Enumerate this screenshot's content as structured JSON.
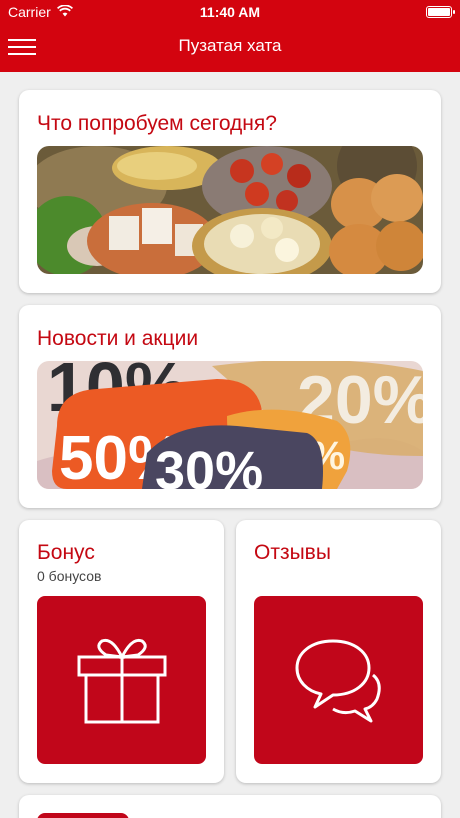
{
  "status_bar": {
    "carrier": "Carrier",
    "time": "11:40 AM"
  },
  "header": {
    "title": "Пузатая хата"
  },
  "cards": {
    "menu": {
      "title": "Что попробуем сегодня?",
      "image_icon": "food-platter-photo"
    },
    "news": {
      "title": "Новости и акции",
      "image_icon": "discount-tags-photo",
      "tags": [
        "10%",
        "50%",
        "30%",
        "20%",
        "30%"
      ]
    },
    "bonus": {
      "title": "Бонус",
      "subtitle": "0 бонусов",
      "icon": "gift-icon"
    },
    "reviews": {
      "title": "Отзывы",
      "icon": "chat-bubbles-icon"
    }
  },
  "colors": {
    "brand_red": "#d3040f",
    "tile_red": "#c1061a",
    "background": "#efefef"
  }
}
